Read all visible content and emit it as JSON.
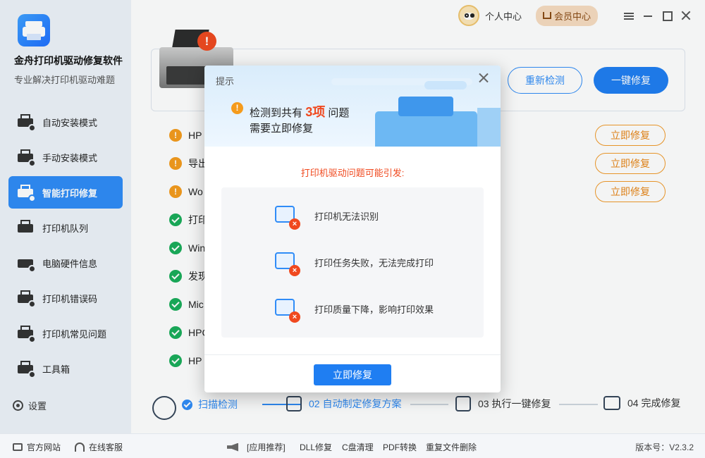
{
  "app": {
    "title": "金舟打印机驱动修复软件",
    "subtitle": "专业解决打印机驱动难题"
  },
  "sidebar": {
    "items": [
      {
        "label": "自动安装模式",
        "icon": "download-printer-icon",
        "active": false
      },
      {
        "label": "手动安装模式",
        "icon": "manual-install-icon",
        "active": false
      },
      {
        "label": "智能打印修复",
        "icon": "ai-repair-icon",
        "active": true
      },
      {
        "label": "打印机队列",
        "icon": "printer-queue-icon",
        "active": false
      },
      {
        "label": "电脑硬件信息",
        "icon": "hardware-info-icon",
        "active": false
      },
      {
        "label": "打印机错误码",
        "icon": "error-code-icon",
        "active": false
      },
      {
        "label": "打印机常见问题",
        "icon": "faq-icon",
        "active": false
      },
      {
        "label": "工具箱",
        "icon": "toolbox-icon",
        "active": false
      }
    ],
    "settings_label": "设置"
  },
  "header": {
    "user_center": "个人中心",
    "vip_center": "会员中心"
  },
  "scan": {
    "recheck_label": "重新检测",
    "fix_all_label": "一键修复",
    "alert_mark": "!"
  },
  "issues": [
    {
      "text": "HP",
      "status": "warn"
    },
    {
      "text": "导出",
      "status": "warn"
    },
    {
      "text": "Wo",
      "status": "warn"
    },
    {
      "text": "打印",
      "status": "ok"
    },
    {
      "text": "Win",
      "status": "ok"
    },
    {
      "text": "发现",
      "status": "ok"
    },
    {
      "text": "Mic",
      "status": "ok"
    },
    {
      "text": "HPC",
      "status": "ok"
    },
    {
      "text": "HP",
      "status": "ok"
    }
  ],
  "fix_button_label": "立即修复",
  "steps": [
    {
      "label": "扫描检测",
      "done": true
    },
    {
      "label": "02 自动制定修复方案",
      "done": true
    },
    {
      "label": "03 执行一键修复",
      "done": false
    },
    {
      "label": "04 完成修复",
      "done": false
    }
  ],
  "footer": {
    "official_site": "官方网站",
    "online_service": "在线客服",
    "links": [
      "[应用推荐]",
      "DLL修复",
      "C盘清理",
      "PDF转换",
      "重复文件删除"
    ],
    "version": "版本号：V2.3.2"
  },
  "dialog": {
    "title": "提示",
    "warn_mark": "!",
    "msg_prefix": "检测到共有",
    "msg_count": "3项",
    "msg_suffix": "问题",
    "msg_line2": "需要立即修复",
    "cause_title": "打印机驱动问题可能引发:",
    "causes": [
      {
        "text": "打印机无法识别",
        "icon": "printer-unrecognized-icon"
      },
      {
        "text": "打印任务失败，无法完成打印",
        "icon": "print-task-failed-icon"
      },
      {
        "text": "打印质量下降，影响打印效果",
        "icon": "print-quality-icon"
      }
    ],
    "x_mark": "×",
    "button_label": "立即修复"
  },
  "colors": {
    "accent": "#1f7ef2",
    "warn": "#f59b1c",
    "error": "#f0491f",
    "ok": "#1aad5a"
  }
}
